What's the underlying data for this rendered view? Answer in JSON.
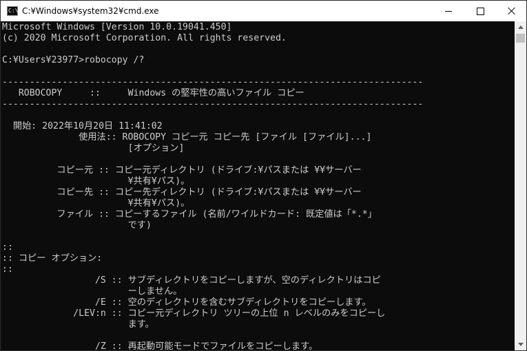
{
  "window": {
    "title": "C:¥Windows¥system32¥cmd.exe",
    "icon_text": "C:\\",
    "icon": "cmd-app-icon"
  },
  "console": {
    "lines": [
      "Microsoft Windows [Version 10.0.19041.450]",
      "(c) 2020 Microsoft Corporation. All rights reserved.",
      "",
      "C:¥Users¥23977>robocopy /?",
      "",
      "-----------------------------------------------------------------------------",
      "   ROBOCOPY     ::     Windows の堅牢性の高いファイル コピー",
      "-----------------------------------------------------------------------------",
      "",
      "  開始: 2022年10月20日 11:41:02",
      "              使用法:: ROBOCOPY コピー元 コピー先 [ファイル [ファイル]...]",
      "                       [オプション]",
      "",
      "          コピー元 :: コピー元ディレクトリ (ドライブ:¥パスまたは ¥¥サーバー",
      "                       ¥共有¥パス)。",
      "          コピー先 :: コピー先ディレクトリ (ドライブ:¥パスまたは ¥¥サーバー",
      "                       ¥共有¥パス)。",
      "          ファイル :: コピーするファイル (名前/ワイルドカード: 既定値は「*.*」",
      "                       です)",
      "",
      "::",
      ":: コピー オプション:",
      "::",
      "                 /S :: サブディレクトリをコピーしますが、空のディレクトリはコピ",
      "                       ーしません。",
      "                 /E :: 空のディレクトリを含むサブディレクトリをコピーします。",
      "             /LEV:n :: コピー元ディレクトリ ツリーの上位 n レベルのみをコピーし",
      "                       ます。",
      "",
      "                 /Z :: 再起動可能モードでファイルをコピーします。"
    ]
  },
  "colors": {
    "console_bg": "#0c0c0c",
    "console_fg": "#cccccc",
    "titlebar_bg": "#ffffff",
    "scrollbar_bg": "#f0f0f0"
  }
}
